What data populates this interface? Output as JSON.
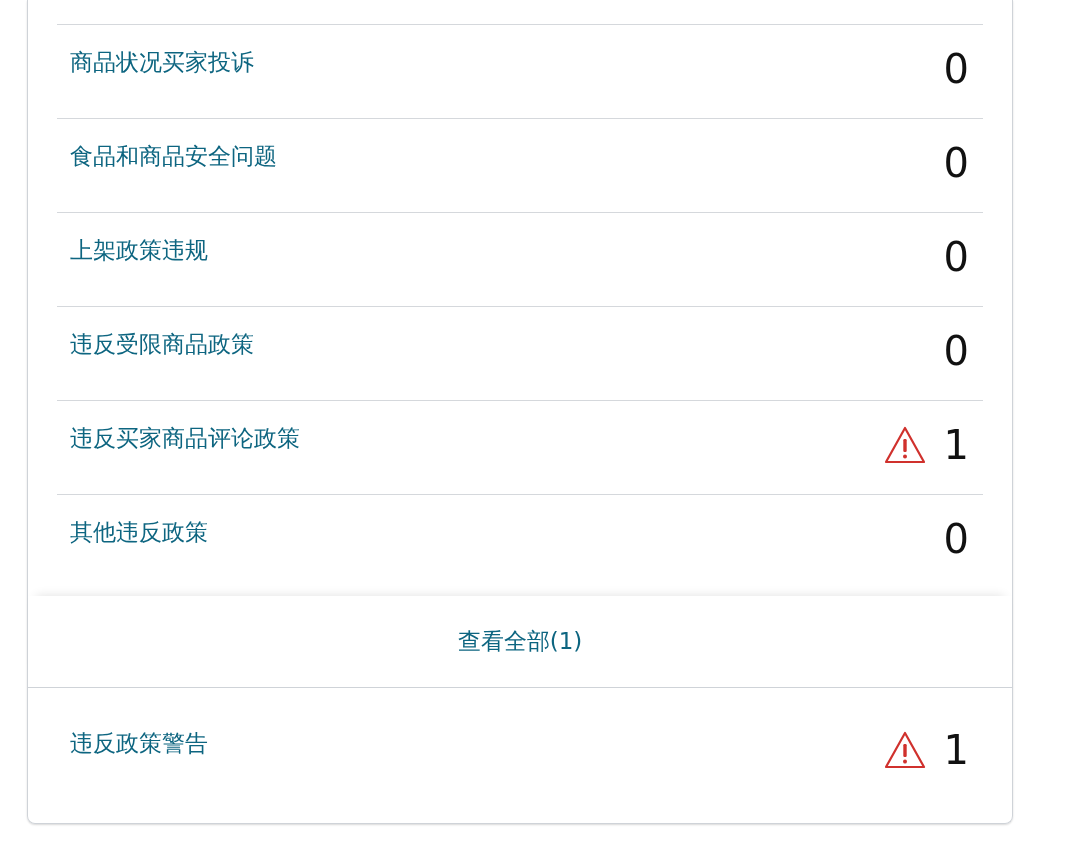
{
  "rows": [
    {
      "label": "商品状况买家投诉",
      "count": "0",
      "warning": false
    },
    {
      "label": "食品和商品安全问题",
      "count": "0",
      "warning": false
    },
    {
      "label": "上架政策违规",
      "count": "0",
      "warning": false
    },
    {
      "label": "违反受限商品政策",
      "count": "0",
      "warning": false
    },
    {
      "label": "违反买家商品评论政策",
      "count": "1",
      "warning": true
    },
    {
      "label": "其他违反政策",
      "count": "0",
      "warning": false
    }
  ],
  "view_all": "查看全部(1)",
  "policy_warnings": {
    "label": "违反政策警告",
    "count": "1",
    "warning": true
  }
}
